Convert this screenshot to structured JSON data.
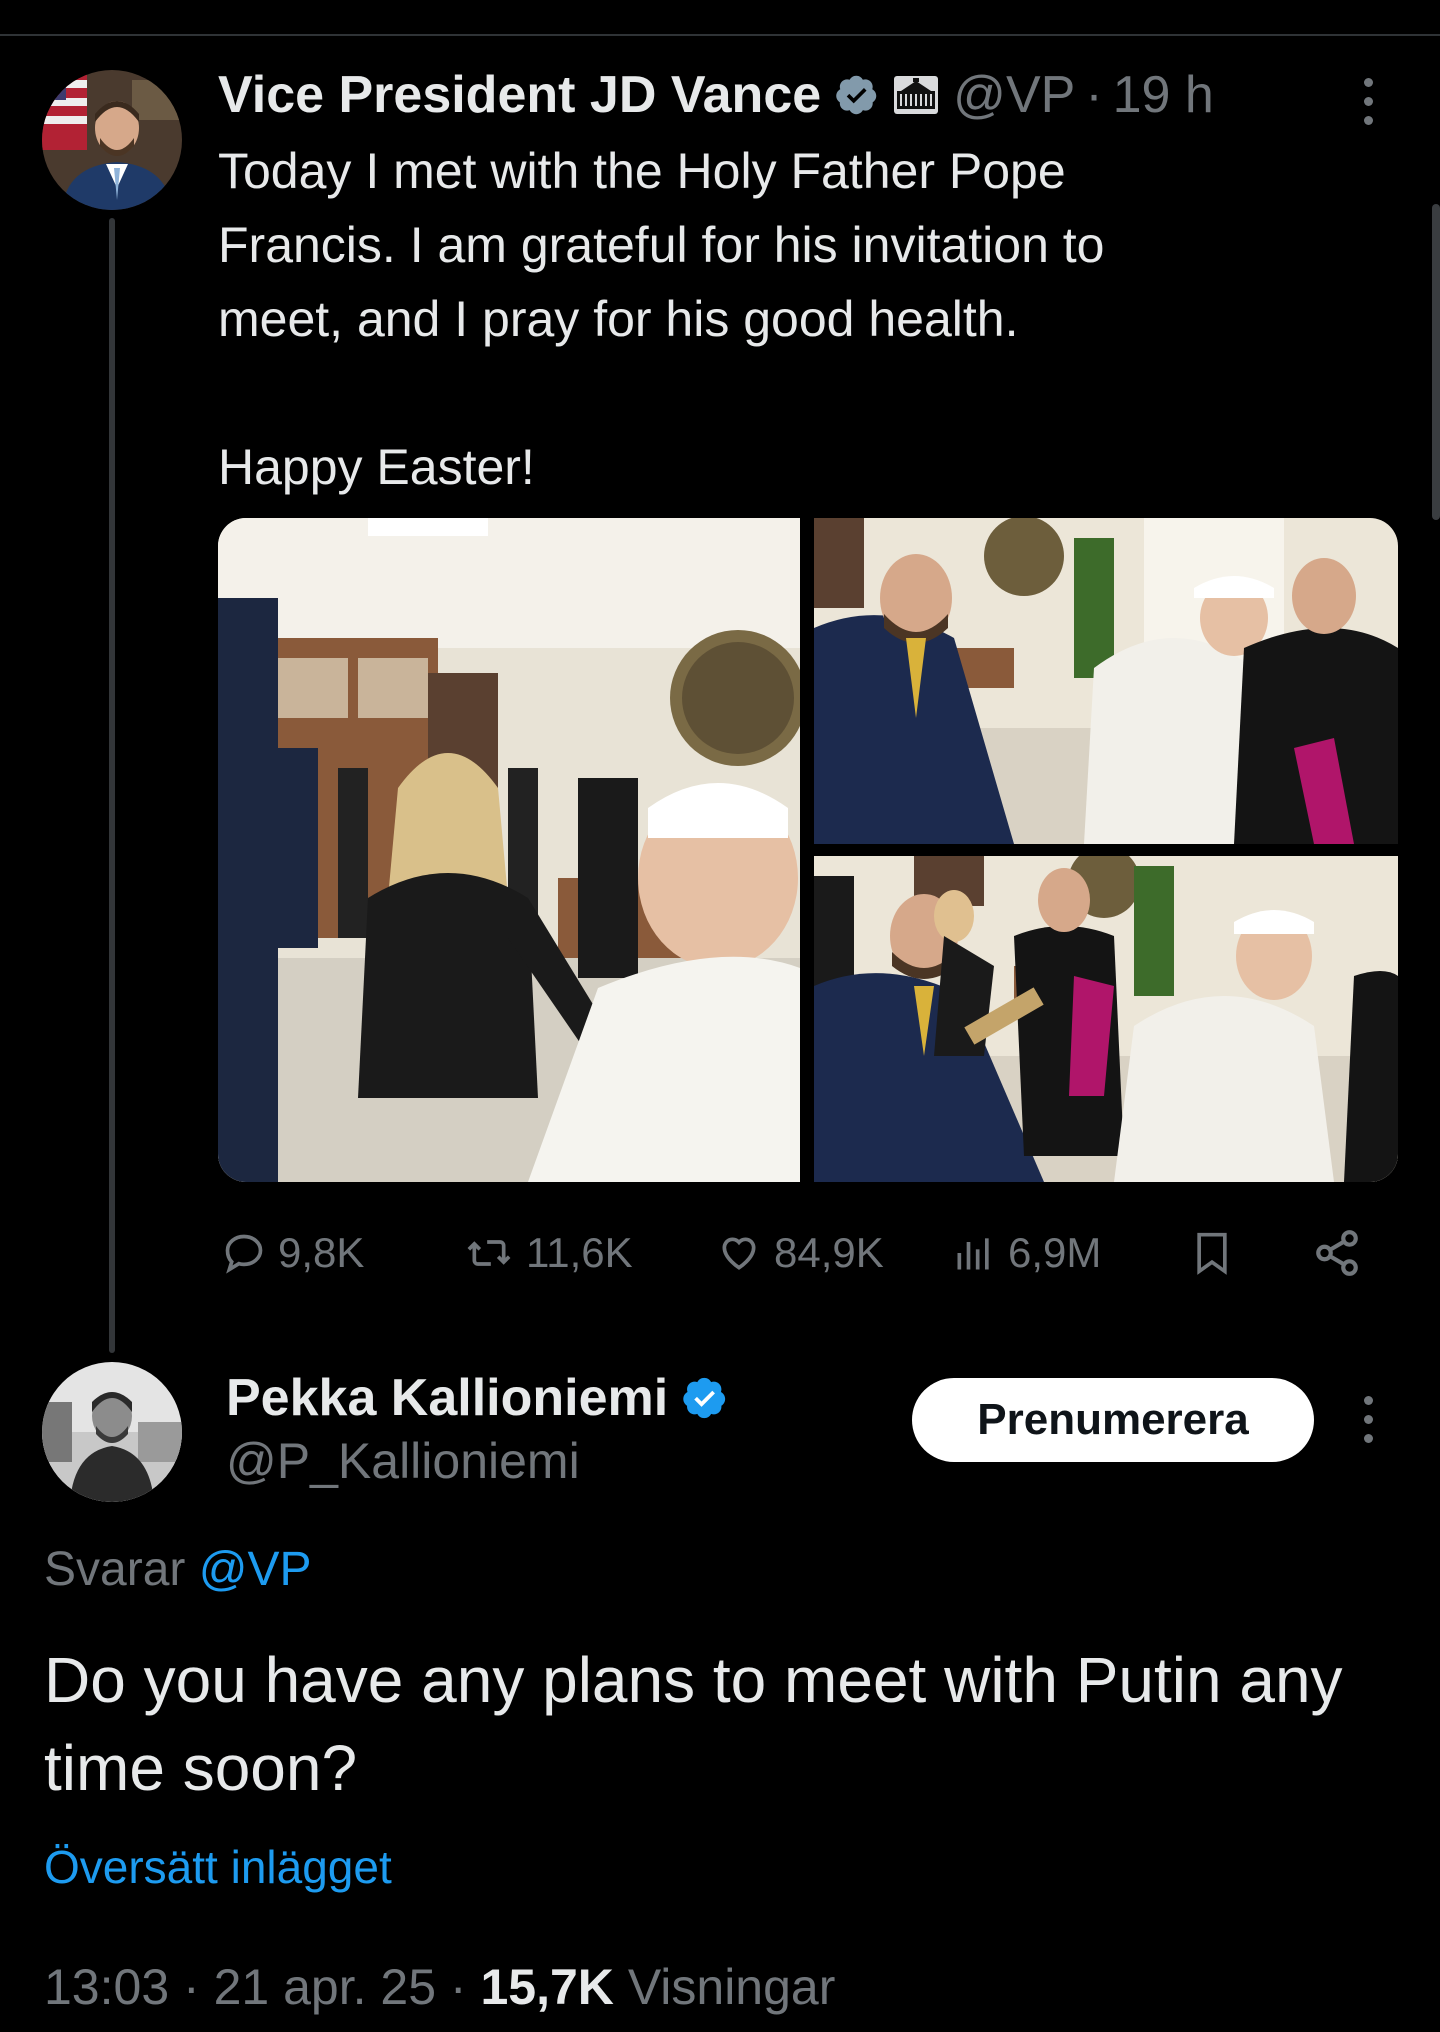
{
  "colors": {
    "background": "#000000",
    "accent": "#1d9bf0",
    "text": "#e7e9ea",
    "muted": "#71767b"
  },
  "original_tweet": {
    "author_name": "Vice President JD Vance",
    "verified_icon": "grey-verified-badge-icon",
    "affiliation_icon": "white-house-icon",
    "handle": "@VP",
    "separator": "·",
    "time": "19 h",
    "text": "Today I met with the Holy Father Pope\nFrancis. I am grateful for his invitation to\nmeet, and I pray for his good health.\n\nHappy Easter!",
    "media_count": 3,
    "actions": {
      "replies": "9,8K",
      "reposts": "11,6K",
      "likes": "84,9K",
      "views": "6,9M"
    }
  },
  "reply_tweet": {
    "author_name": "Pekka Kallioniemi",
    "verified_icon": "blue-verified-badge-icon",
    "handle": "@P_Kallioniemi",
    "subscribe_label": "Prenumerera",
    "replying_prefix": "Svarar",
    "replying_to": "@VP",
    "text": "Do you have any plans to meet with Putin any time soon?",
    "translate_label": "Översätt inlägget",
    "time": "13:03",
    "separator": "·",
    "date": "21 apr. 25",
    "views_count": "15,7K",
    "views_label": "Visningar"
  }
}
